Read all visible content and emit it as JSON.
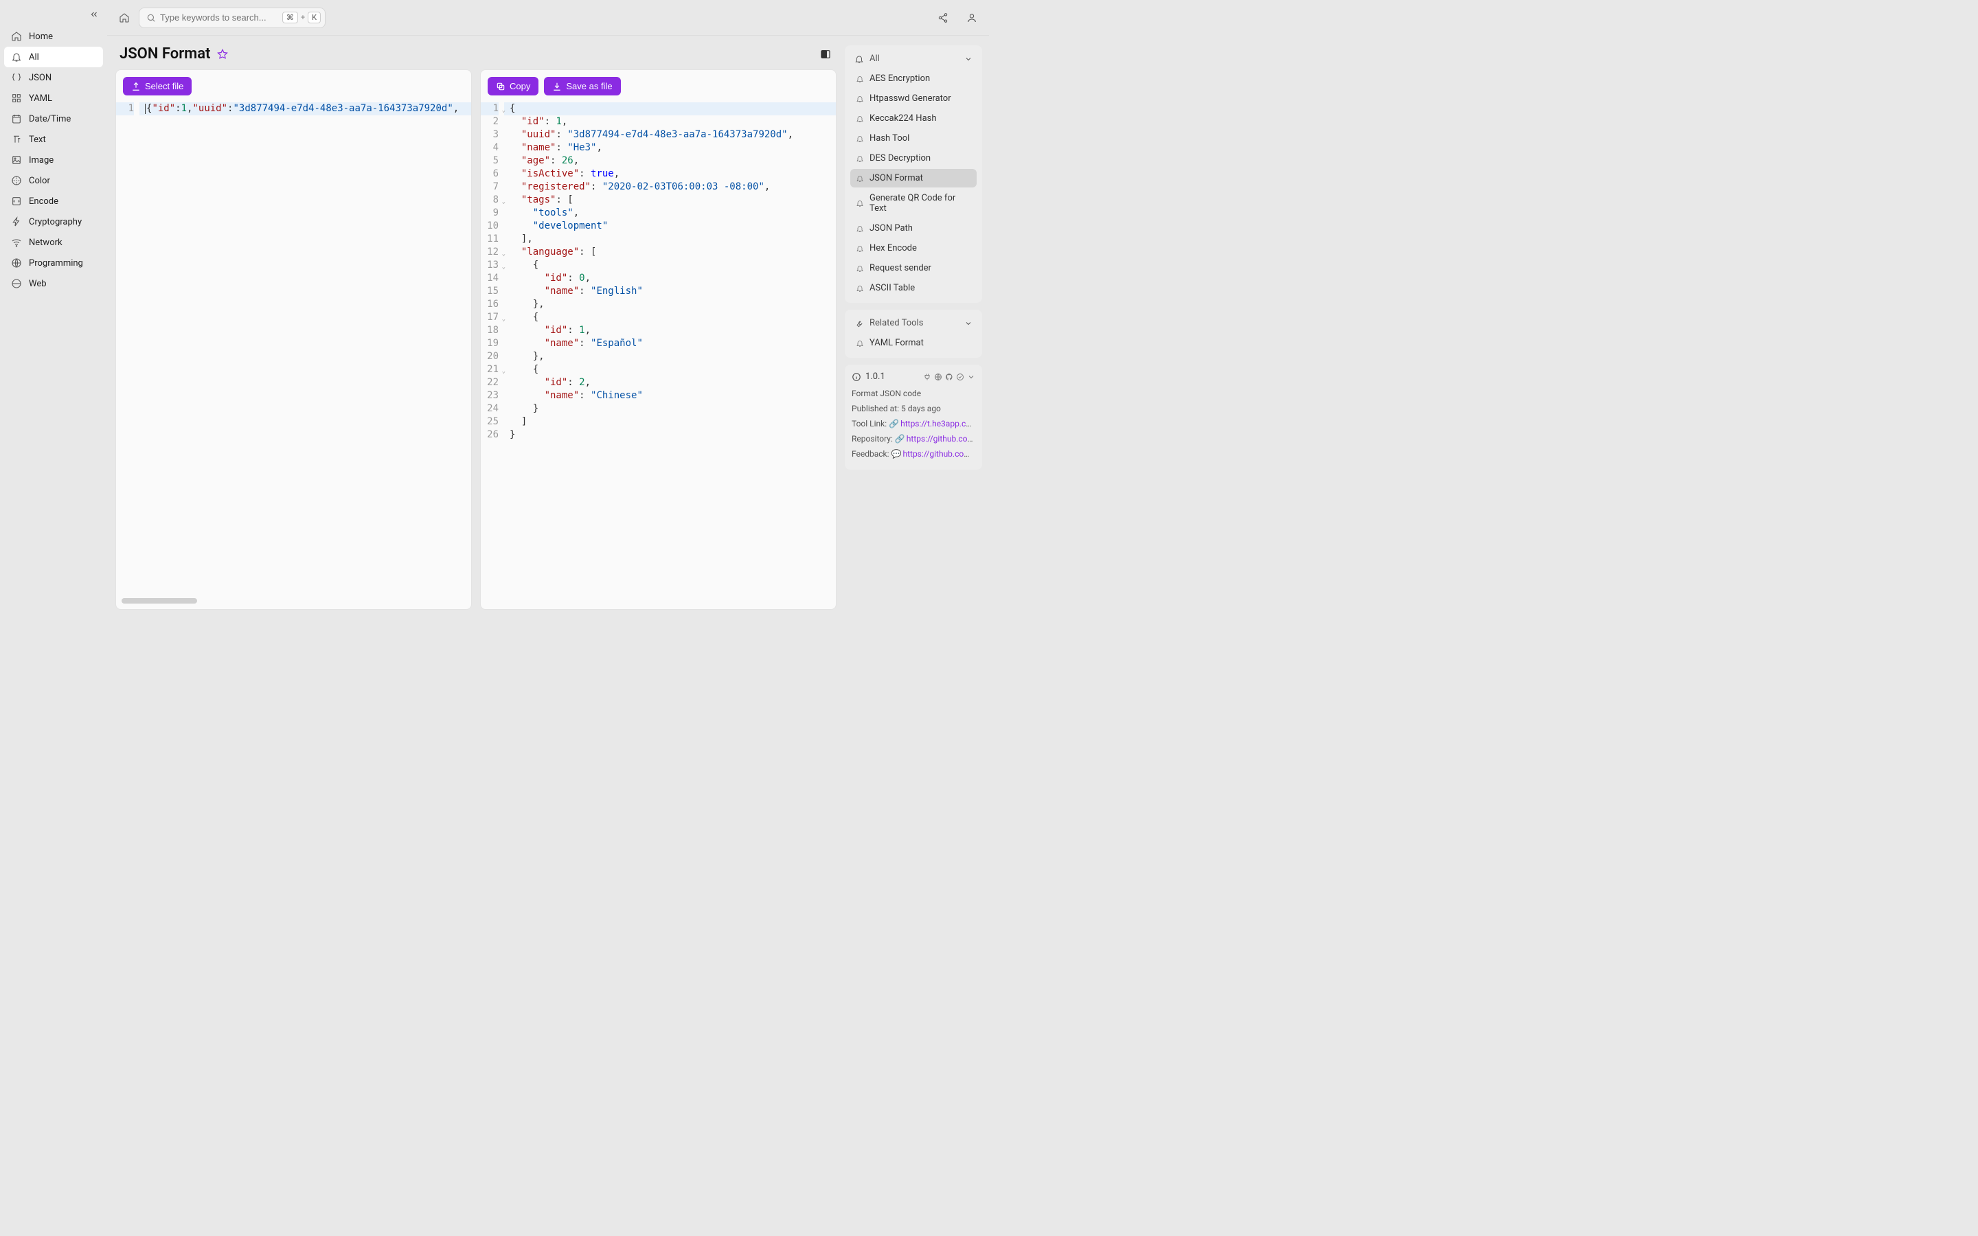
{
  "search": {
    "placeholder": "Type keywords to search...",
    "kbd1": "⌘",
    "plus": "+",
    "kbd2": "K"
  },
  "page": {
    "title": "JSON Format"
  },
  "nav": [
    {
      "icon": "home",
      "label": "Home"
    },
    {
      "icon": "bell",
      "label": "All",
      "active": true
    },
    {
      "icon": "braces",
      "label": "JSON"
    },
    {
      "icon": "grid",
      "label": "YAML"
    },
    {
      "icon": "calendar",
      "label": "Date/Time"
    },
    {
      "icon": "text",
      "label": "Text"
    },
    {
      "icon": "image",
      "label": "Image"
    },
    {
      "icon": "palette",
      "label": "Color"
    },
    {
      "icon": "encode",
      "label": "Encode"
    },
    {
      "icon": "bolt",
      "label": "Cryptography"
    },
    {
      "icon": "wifi",
      "label": "Network"
    },
    {
      "icon": "globe",
      "label": "Programming"
    },
    {
      "icon": "web",
      "label": "Web"
    }
  ],
  "leftPane": {
    "selectFile": "Select file",
    "line1": "{\"id\":1,\"uuid\":\"3d877494-e7d4-48e3-aa7a-164373a7920d\","
  },
  "rightPane": {
    "copy": "Copy",
    "save": "Save as file"
  },
  "json": {
    "id": 1,
    "uuid": "3d877494-e7d4-48e3-aa7a-164373a7920d",
    "name": "He3",
    "age": 26,
    "isActive": true,
    "registered": "2020-02-03T06:00:03 -08:00",
    "tags": [
      "tools",
      "development"
    ],
    "language": [
      {
        "id": 0,
        "name": "English"
      },
      {
        "id": 1,
        "name": "Español"
      },
      {
        "id": 2,
        "name": "Chinese"
      }
    ]
  },
  "rightSidebar": {
    "allHeader": "All",
    "tools": [
      "AES Encryption",
      "Htpasswd Generator",
      "Keccak224 Hash",
      "Hash Tool",
      "DES Decryption",
      "JSON Format",
      "Generate QR Code for Text",
      "JSON Path",
      "Hex Encode",
      "Request sender",
      "ASCII Table"
    ],
    "selectedIndex": 5,
    "relatedHeader": "Related Tools",
    "related": [
      "YAML Format"
    ]
  },
  "info": {
    "version": "1.0.1",
    "desc": "Format JSON code",
    "publishedLabel": "Published at:",
    "published": "5 days ago",
    "toolLinkLabel": "Tool Link:",
    "toolLink": "https://t.he3app.co…",
    "repoLabel": "Repository:",
    "repo": "https://github.com…",
    "feedbackLabel": "Feedback:",
    "feedback": "https://github.com/…"
  }
}
